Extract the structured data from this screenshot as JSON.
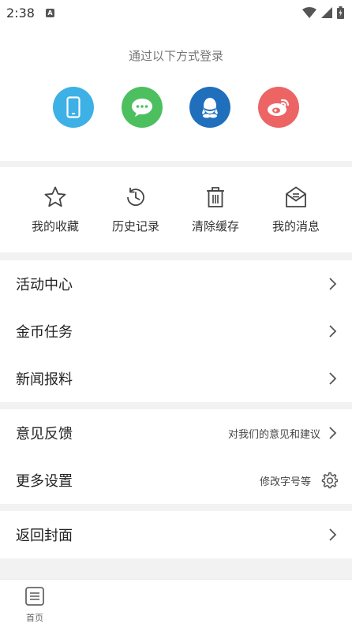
{
  "status_bar": {
    "time": "2:38",
    "app_badge": "A"
  },
  "login": {
    "title": "通过以下方式登录",
    "methods": [
      {
        "name": "phone",
        "icon": "phone-icon",
        "color": "#3db0e6"
      },
      {
        "name": "wechat",
        "icon": "wechat-icon",
        "color": "#4cc05f"
      },
      {
        "name": "qq",
        "icon": "qq-icon",
        "color": "#1f6fbd"
      },
      {
        "name": "weibo",
        "icon": "weibo-icon",
        "color": "#ec6464"
      }
    ]
  },
  "quick_actions": [
    {
      "label": "我的收藏",
      "icon": "star-icon"
    },
    {
      "label": "历史记录",
      "icon": "history-icon"
    },
    {
      "label": "清除缓存",
      "icon": "trash-icon"
    },
    {
      "label": "我的消息",
      "icon": "envelope-icon"
    }
  ],
  "menu_group_1": [
    {
      "label": "活动中心"
    },
    {
      "label": "金币任务"
    },
    {
      "label": "新闻报料"
    }
  ],
  "menu_group_2": [
    {
      "label": "意见反馈",
      "hint": "对我们的意见和建议"
    },
    {
      "label": "更多设置",
      "hint": "修改字号等"
    }
  ],
  "menu_group_3": [
    {
      "label": "返回封面"
    }
  ],
  "bottom_nav": {
    "home_label": "首页"
  }
}
